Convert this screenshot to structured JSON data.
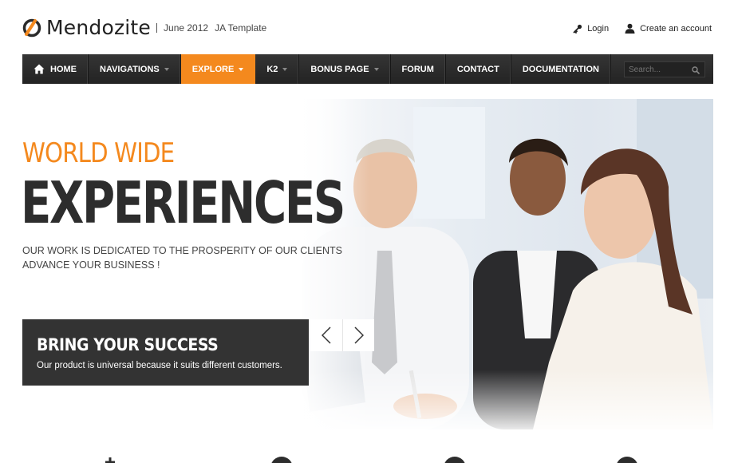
{
  "header": {
    "brand": "Mendozite",
    "tagline_date": "June 2012",
    "tagline_template": "JA Template",
    "login_label": "Login",
    "create_account_label": "Create an account"
  },
  "nav": {
    "items": [
      {
        "label": "HOME",
        "icon": "home-icon",
        "dropdown": false
      },
      {
        "label": "NAVIGATIONS",
        "dropdown": true
      },
      {
        "label": "EXPLORE",
        "dropdown": true,
        "active": true
      },
      {
        "label": "K2",
        "dropdown": true
      },
      {
        "label": "BONUS PAGE",
        "dropdown": true
      },
      {
        "label": "FORUM",
        "dropdown": false
      },
      {
        "label": "CONTACT",
        "dropdown": false
      },
      {
        "label": "DOCUMENTATION",
        "dropdown": false
      }
    ],
    "search_placeholder": "Search..."
  },
  "hero": {
    "kicker": "WORLD WIDE",
    "title": "EXPERIENCES",
    "desc_line1": "OUR WORK IS DEDICATED TO THE PROSPERITY OF OUR CLIENTS",
    "desc_line2": "ADVANCE YOUR BUSINESS !",
    "caption_title": "BRING YOUR SUCCESS",
    "caption_text": "Our product is universal because it suits different customers.",
    "photo": "business-team-photo"
  },
  "colors": {
    "accent": "#f4891e",
    "nav_bg": "#2b2b2b",
    "caption_bg": "#333333",
    "title_text": "#2d2d2d"
  }
}
